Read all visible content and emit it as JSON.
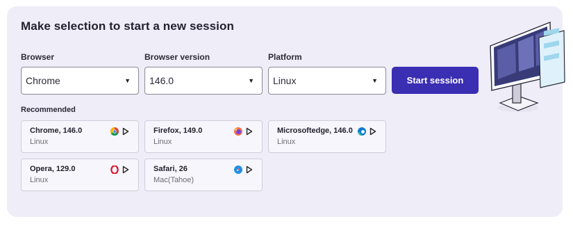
{
  "title": "Make selection to start a new session",
  "fields": [
    {
      "label": "Browser",
      "value": "Chrome"
    },
    {
      "label": "Browser version",
      "value": "146.0"
    },
    {
      "label": "Platform",
      "value": "Linux"
    }
  ],
  "start_button": "Start session",
  "recommended_label": "Recommended",
  "recommended": [
    {
      "name": "Chrome, 146.0",
      "os": "Linux",
      "icon": "chrome-icon"
    },
    {
      "name": "Firefox, 149.0",
      "os": "Linux",
      "icon": "firefox-icon"
    },
    {
      "name": "Microsoftedge, 146.0",
      "os": "Linux",
      "icon": "edge-icon"
    },
    {
      "name": "Opera, 129.0",
      "os": "Linux",
      "icon": "opera-icon"
    },
    {
      "name": "Safari, 26",
      "os": "Mac(Tahoe)",
      "icon": "safari-icon"
    }
  ],
  "colors": {
    "accent": "#3a2eb3",
    "panel": "#efedf8"
  }
}
